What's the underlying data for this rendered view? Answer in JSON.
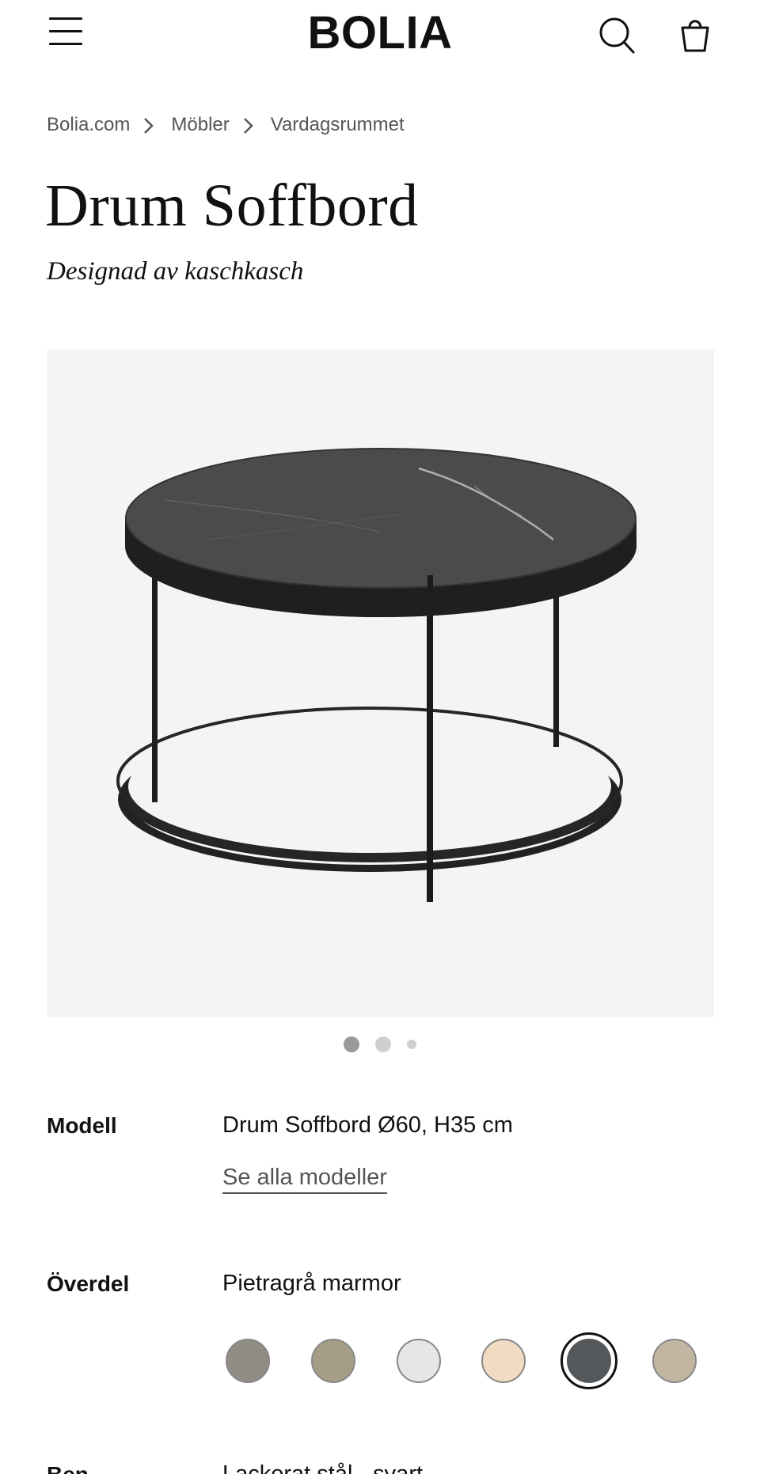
{
  "header": {
    "logo": "BOLIA"
  },
  "breadcrumb": [
    "Bolia.com",
    "Möbler",
    "Vardagsrummet"
  ],
  "product": {
    "title": "Drum Soffbord",
    "designer": "Designad av kaschkasch"
  },
  "gallery": {
    "image_count": 3,
    "active_index": 0
  },
  "specs": {
    "model_label": "Modell",
    "model_value": "Drum Soffbord Ø60, H35 cm",
    "see_all_models": "Se alla modeller",
    "top_label": "Överdel",
    "top_value": "Pietragrå marmor",
    "base_label": "Ben",
    "base_value": "Lackerat stål - svart"
  },
  "swatches": [
    {
      "name": "grey-stone",
      "color": "#918c84"
    },
    {
      "name": "olive-stone",
      "color": "#a59d86"
    },
    {
      "name": "light-grey",
      "color": "#e7e6e4"
    },
    {
      "name": "beige",
      "color": "#f1dcc3"
    },
    {
      "name": "pietragra-marble",
      "color": "#55585a",
      "selected": true
    },
    {
      "name": "travertine",
      "color": "#c2b6a3"
    }
  ],
  "colors": {
    "text": "#111111",
    "muted": "#555555",
    "gallery_bg": "#f4f4f4"
  }
}
